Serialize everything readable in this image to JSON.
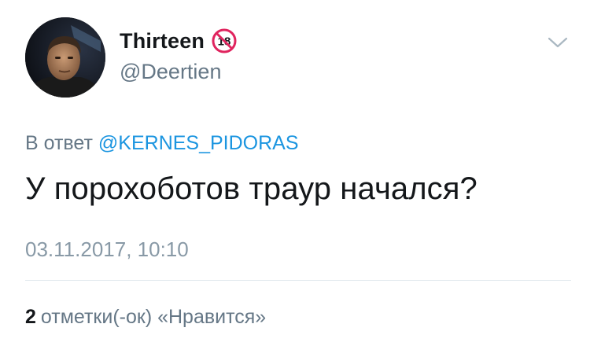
{
  "author": {
    "display_name": "Thirteen",
    "handle": "@Deertien",
    "badge_icon": "eighteen-plus-icon",
    "avatar_icon": "profile-photo"
  },
  "menu": {
    "icon": "chevron-down-icon"
  },
  "reply": {
    "prefix": "В ответ",
    "mention": "@KERNES_PIDORAS"
  },
  "tweet": {
    "text": "У порохоботов траур начался?",
    "timestamp": "03.11.2017, 10:10"
  },
  "stats": {
    "likes_count": "2",
    "likes_label": "отметки(-ок) «Нравится»"
  },
  "colors": {
    "text_primary": "#14171a",
    "text_secondary": "#657786",
    "link": "#1b95e0",
    "badge_red": "#e0245e",
    "divider": "#e1e8ed"
  }
}
